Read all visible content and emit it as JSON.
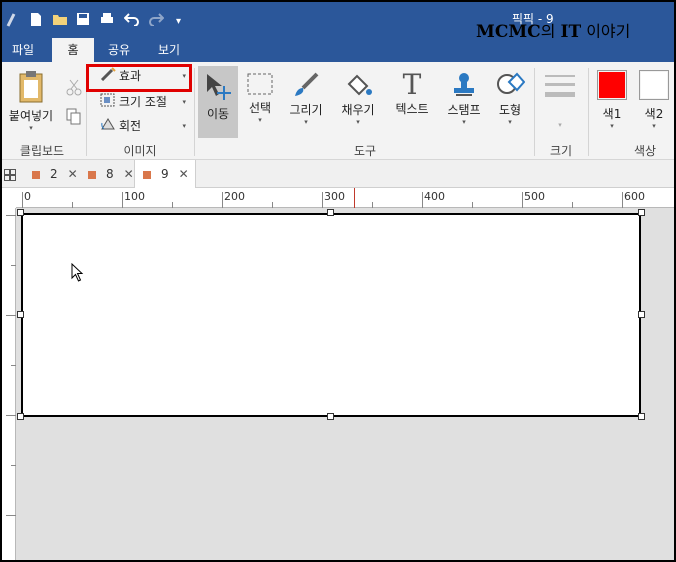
{
  "titlebar": {
    "doc_title": "픽픽 - 9",
    "watermark_bold": "MCMC",
    "watermark_mid": "의 ",
    "watermark_it": "IT",
    "watermark_end": " 이야기"
  },
  "tabs": [
    {
      "label": "파일"
    },
    {
      "label": "홈"
    },
    {
      "label": "공유"
    },
    {
      "label": "보기"
    }
  ],
  "ribbon": {
    "clipboard": {
      "paste_label": "붙여넣기",
      "group_label": "클립보드"
    },
    "image": {
      "effect_label": "효과",
      "resize_label": "크기 조절",
      "rotate_label": "회전",
      "group_label": "이미지"
    },
    "tools": {
      "move_label": "이동",
      "select_label": "선택",
      "draw_label": "그리기",
      "fill_label": "채우기",
      "text_label": "텍스트",
      "stamp_label": "스탬프",
      "shape_label": "도형",
      "group_label": "도구"
    },
    "size": {
      "group_label": "크기"
    },
    "color": {
      "color1_label": "색1",
      "color2_label": "색2",
      "group_label": "색상",
      "color1": "#ff0000",
      "color2": "#ffffff"
    }
  },
  "doc_tabs": [
    {
      "label": "2"
    },
    {
      "label": "8"
    },
    {
      "label": "9"
    }
  ],
  "ruler": {
    "labels": [
      "0",
      "100",
      "200",
      "300",
      "400",
      "500",
      "600"
    ]
  },
  "colors": {
    "titlebar": "#2b579a",
    "highlight": "#e00000",
    "tab_marker": "#d9774b"
  }
}
